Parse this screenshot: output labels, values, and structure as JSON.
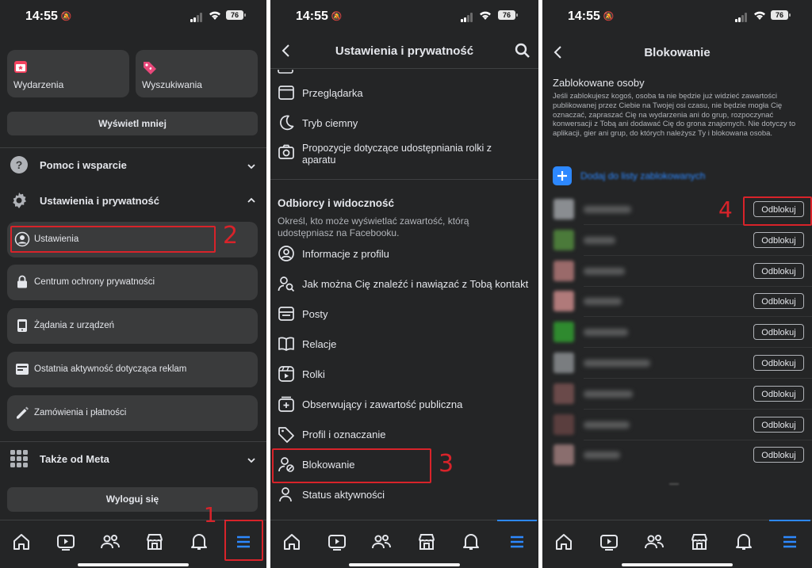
{
  "status_bar": {
    "time": "14:55",
    "battery": "76"
  },
  "panel1": {
    "shortcuts": [
      {
        "label": "Wydarzenia"
      },
      {
        "label": "Wyszukiwania"
      }
    ],
    "show_less": "Wyświetl mniej",
    "help_support": "Pomoc i wsparcie",
    "settings_privacy": "Ustawienia i prywatność",
    "sub_items": [
      {
        "label": "Ustawienia"
      },
      {
        "label": "Centrum ochrony prywatności"
      },
      {
        "label": "Żądania z urządzeń"
      },
      {
        "label": "Ostatnia aktywność dotycząca reklam"
      },
      {
        "label": "Zamówienia i płatności"
      }
    ],
    "also_from_meta": "Także od Meta",
    "logout": "Wyloguj się"
  },
  "panel2": {
    "title": "Ustawienia i prywatność",
    "items_top": [
      {
        "label": "Przeglądarka"
      },
      {
        "label": "Tryb ciemny"
      },
      {
        "label": "Propozycje dotyczące udostępniania rolki z aparatu"
      }
    ],
    "section_title": "Odbiorcy i widoczność",
    "section_desc": "Określ, kto może wyświetlać zawartość, którą udostępniasz na Facebooku.",
    "items": [
      {
        "label": "Informacje z profilu"
      },
      {
        "label": "Jak można Cię znaleźć i nawiązać z Tobą kontakt"
      },
      {
        "label": "Posty"
      },
      {
        "label": "Relacje"
      },
      {
        "label": "Rolki"
      },
      {
        "label": "Obserwujący i zawartość publiczna"
      },
      {
        "label": "Profil i oznaczanie"
      },
      {
        "label": "Blokowanie"
      },
      {
        "label": "Status aktywności"
      }
    ]
  },
  "panel3": {
    "title": "Blokowanie",
    "section_title": "Zablokowane osoby",
    "section_desc": "Jeśli zablokujesz kogoś, osoba ta nie będzie już widzieć zawartości publikowanej przez Ciebie na Twojej osi czasu, nie będzie mogła Cię oznaczać, zapraszać Cię na wydarzenia ani do grup, rozpoczynać konwersacji z Tobą ani dodawać Cię do grona znajomych. Nie dotyczy to aplikacji, gier ani grup, do których należysz Ty i blokowana osoba.",
    "add_label": "Dodaj do listy zablokowanych",
    "unblock_label": "Odblokuj",
    "blocked_count": 9
  },
  "annotations": [
    "1",
    "2",
    "3",
    "4"
  ],
  "colors": {
    "background": "#242526",
    "card": "#3a3b3c",
    "accent": "#2d88ff",
    "annotation": "#d8232a"
  }
}
